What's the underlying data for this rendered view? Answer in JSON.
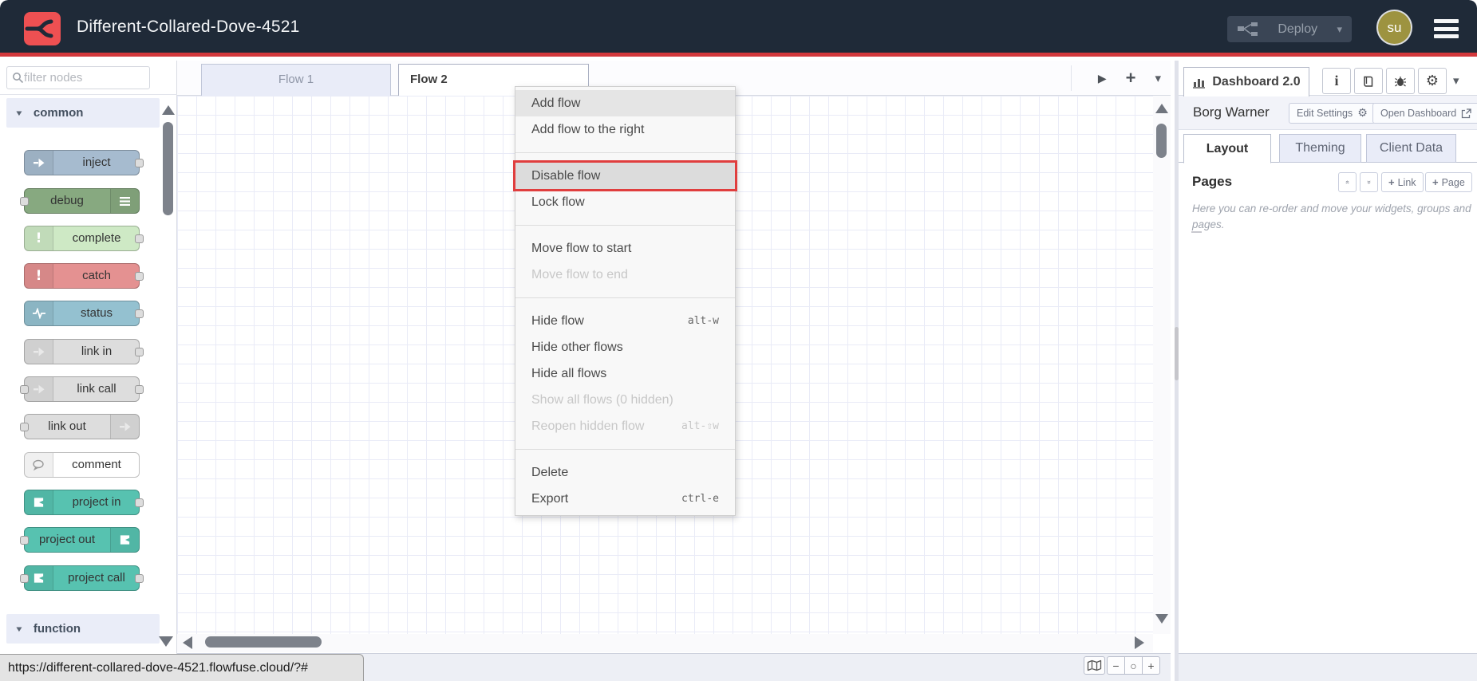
{
  "header": {
    "title": "Different-Collared-Dove-4521",
    "deploy_label": "Deploy",
    "avatar_initials": "su"
  },
  "palette": {
    "filter_placeholder": "filter nodes",
    "categories": [
      {
        "label": "common",
        "nodes": [
          {
            "label": "inject",
            "color": "#a6bbcf",
            "icon": "inject-icon",
            "icon_side": "left",
            "ports": [
              "out"
            ]
          },
          {
            "label": "debug",
            "color": "#87a980",
            "icon": "debug-icon",
            "icon_side": "right",
            "ports": [
              "in"
            ]
          },
          {
            "label": "complete",
            "color": "#cee9c5",
            "icon": "alert-icon",
            "icon_side": "left",
            "ports": [
              "out"
            ]
          },
          {
            "label": "catch",
            "color": "#e49191",
            "icon": "alert-icon",
            "icon_side": "left",
            "ports": [
              "out"
            ]
          },
          {
            "label": "status",
            "color": "#94c1d0",
            "icon": "status-icon",
            "icon_side": "left",
            "ports": [
              "out"
            ]
          },
          {
            "label": "link in",
            "color": "#dddddd",
            "icon": "link-icon",
            "icon_side": "left",
            "ports": [
              "out"
            ]
          },
          {
            "label": "link call",
            "color": "#dddddd",
            "icon": "link-icon",
            "icon_side": "left",
            "ports": [
              "in",
              "out"
            ]
          },
          {
            "label": "link out",
            "color": "#dddddd",
            "icon": "link-icon",
            "icon_side": "right",
            "ports": [
              "in"
            ]
          },
          {
            "label": "comment",
            "color": "#ffffff",
            "icon": "comment-icon",
            "icon_side": "left",
            "ports": []
          },
          {
            "label": "project in",
            "color": "#57c2b0",
            "icon": "project-icon",
            "icon_side": "left",
            "ports": [
              "out"
            ]
          },
          {
            "label": "project out",
            "color": "#57c2b0",
            "icon": "project-icon",
            "icon_side": "right",
            "ports": [
              "in"
            ]
          },
          {
            "label": "project call",
            "color": "#57c2b0",
            "icon": "project-icon",
            "icon_side": "left",
            "ports": [
              "in",
              "out"
            ]
          }
        ]
      },
      {
        "label": "function",
        "nodes": []
      }
    ]
  },
  "workspace": {
    "tabs": [
      {
        "label": "Flow 1",
        "active": false
      },
      {
        "label": "Flow 2",
        "active": true
      }
    ]
  },
  "context_menu": {
    "items": [
      {
        "label": "Add flow",
        "state": "hovered"
      },
      {
        "label": "Add flow to the right"
      },
      {
        "type": "separator"
      },
      {
        "label": "Disable flow",
        "state": "highlighted"
      },
      {
        "label": "Lock flow"
      },
      {
        "type": "separator"
      },
      {
        "label": "Move flow to start"
      },
      {
        "label": "Move flow to end",
        "state": "disabled"
      },
      {
        "type": "separator"
      },
      {
        "label": "Hide flow",
        "shortcut": "alt-w"
      },
      {
        "label": "Hide other flows"
      },
      {
        "label": "Hide all flows"
      },
      {
        "label": "Show all flows (0 hidden)",
        "state": "disabled"
      },
      {
        "label": "Reopen hidden flow",
        "state": "disabled",
        "shortcut": "alt-⇧w"
      },
      {
        "type": "separator"
      },
      {
        "label": "Delete"
      },
      {
        "label": "Export",
        "shortcut": "ctrl-e"
      }
    ]
  },
  "sidebar": {
    "active_tab": "Dashboard 2.0",
    "instance_name": "Borg Warner",
    "edit_settings_label": "Edit Settings",
    "open_dashboard_label": "Open Dashboard",
    "tabs": [
      {
        "label": "Layout",
        "active": true
      },
      {
        "label": "Theming",
        "active": false
      },
      {
        "label": "Client Data",
        "active": false
      }
    ],
    "pages_title": "Pages",
    "link_button_label": "Link",
    "page_button_label": "Page",
    "help_text": "Here you can re-order and move your widgets, groups and pages."
  },
  "canvas_footer": {
    "zoom_out_label": "−",
    "zoom_reset_label": "○",
    "zoom_in_label": "+"
  },
  "status_bar": {
    "url": "https://different-collared-dove-4521.flowfuse.cloud/?#"
  },
  "colors": {
    "header_bg": "#1f2a38",
    "accent_red": "#d3383c",
    "logo_red": "#ee5052",
    "avatar_olive": "#9d9340",
    "menu_highlight_border": "#e03e3e",
    "project_node_teal": "#57c2b0",
    "inactive_tab_bg": "#e9ecf8"
  }
}
